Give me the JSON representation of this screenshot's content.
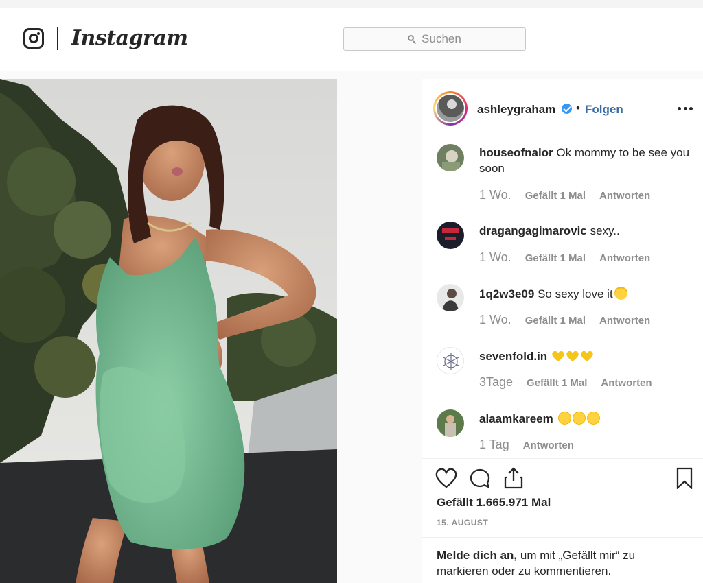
{
  "header": {
    "logo_text": "Instagram",
    "search_placeholder": "Suchen"
  },
  "post": {
    "username": "ashleygraham",
    "follow_label": "Folgen",
    "separator": "•",
    "likes_label": "Gefällt 1.665.971 Mal",
    "date": "15. AUGUST"
  },
  "comments": [
    {
      "user": "houseofnalor",
      "text": "Ok mommy to be see you soon",
      "age": "1 Wo.",
      "likes": "Gefällt 1 Mal",
      "reply": "Antworten"
    },
    {
      "user": "dragangagimarovic",
      "text": "sexy..",
      "age": "1 Wo.",
      "likes": "Gefällt 1 Mal",
      "reply": "Antworten"
    },
    {
      "user": "1q2w3e09",
      "text": "So sexy love it",
      "age": "1 Wo.",
      "likes": "Gefällt 1 Mal",
      "reply": "Antworten",
      "emoji": "heart-eyes-emoji"
    },
    {
      "user": "sevenfold.in",
      "text": "",
      "age": "3Tage",
      "likes": "Gefällt 1 Mal",
      "reply": "Antworten",
      "emoji": "yellow-heart-emoji x3"
    },
    {
      "user": "alaamkareem",
      "text": "",
      "age": "1 Tag",
      "reply": "Antworten",
      "emoji": "kissing-face-emoji x3"
    }
  ],
  "login_prompt": {
    "link": "Melde dich an,",
    "text": " um mit „Gefällt mir“ zu markieren oder zu kommentieren."
  },
  "icons": {
    "logo": "instagram-glyph-icon",
    "search": "search-icon",
    "verified": "verified-badge-icon",
    "more": "more-options-icon",
    "like": "heart-icon",
    "comment": "comment-bubble-icon",
    "share": "share-icon",
    "save": "bookmark-icon"
  },
  "colors": {
    "follow_blue": "#3a6da3",
    "verified_blue": "#3897f0",
    "text": "#262626",
    "muted": "#8e8e8e"
  }
}
